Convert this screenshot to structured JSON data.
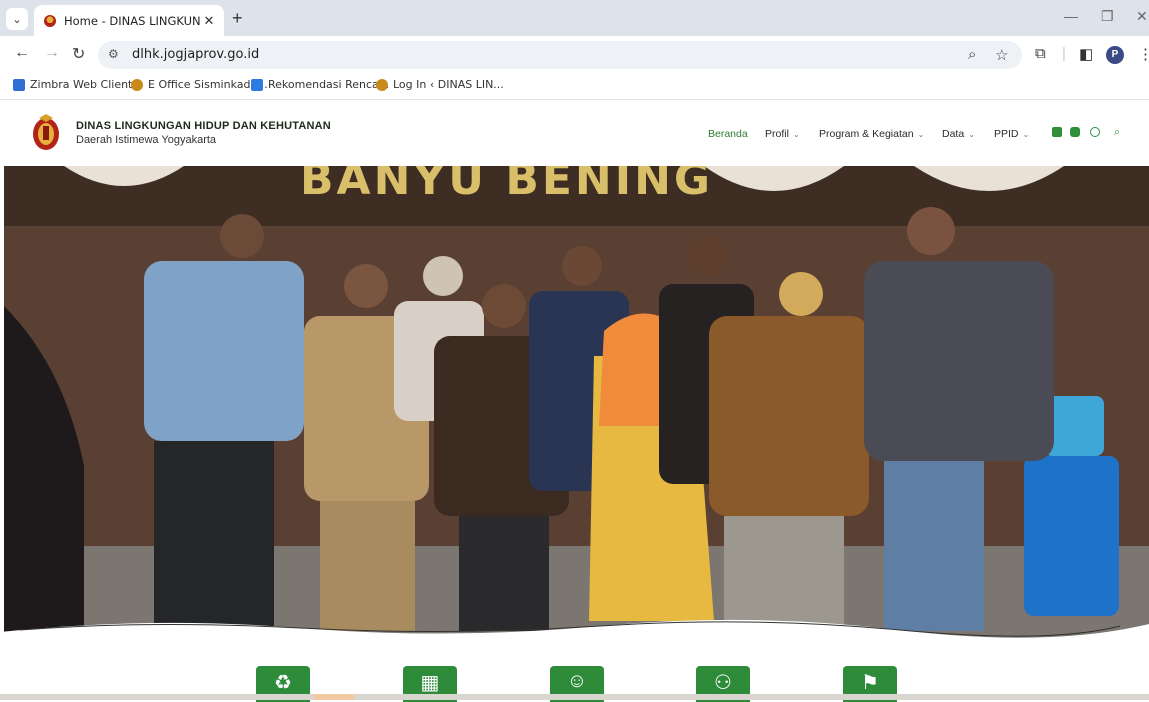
{
  "browser": {
    "tab_title": "Home - DINAS LINGKUNGAN H",
    "url": "dlhk.jogjaprov.go.id",
    "profile_initial": "P",
    "bookmarks": [
      {
        "label": "Zimbra Web Client...",
        "color": "#2f6fd6"
      },
      {
        "label": "E Office Sisminkada...",
        "color": "#c88a1a"
      },
      {
        "label": "Rekomendasi Renca...",
        "color": "#2d7be0"
      },
      {
        "label": "Log In ‹ DINAS LIN...",
        "color": "#c88a1a"
      }
    ]
  },
  "site": {
    "name": "DINAS LINGKUNGAN HIDUP DAN KEHUTANAN",
    "subtitle": "Daerah Istimewa Yogyakarta",
    "nav": [
      {
        "label": "Beranda",
        "active": true
      },
      {
        "label": "Profil"
      },
      {
        "label": "Program & Kegiatan"
      },
      {
        "label": "Data"
      },
      {
        "label": "PPID"
      }
    ],
    "social": [
      "instagram-icon",
      "youtube-icon",
      "whatsapp-icon"
    ],
    "accent_color": "#2f8f3a"
  },
  "hero": {
    "banner_text": "BANYU BENING"
  },
  "features": [
    {
      "icon": "recycle-worker-icon"
    },
    {
      "icon": "dashboard-icon"
    },
    {
      "icon": "chat-consult-icon"
    },
    {
      "icon": "people-group-icon"
    },
    {
      "icon": "map-report-icon"
    }
  ]
}
